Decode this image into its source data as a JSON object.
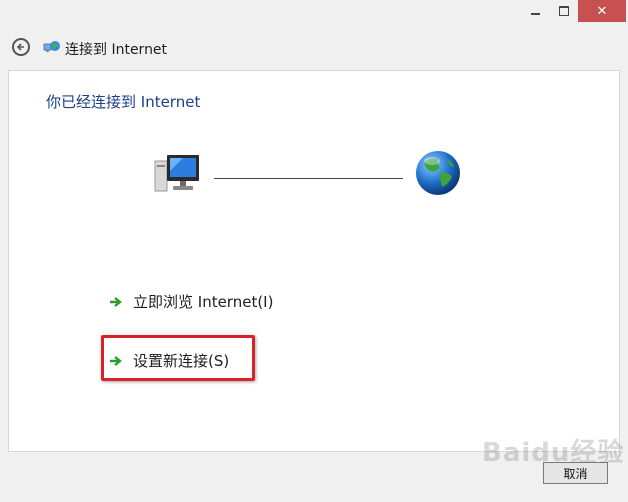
{
  "window": {
    "minimize_glyph": "—",
    "maximize_glyph": "□",
    "close_glyph": "✕"
  },
  "nav": {
    "title": "连接到 Internet",
    "back_icon": "back-arrow-icon",
    "app_icon": "network-connection-icon"
  },
  "main": {
    "heading": "你已经连接到 Internet",
    "computer_icon": "computer-icon",
    "globe_icon": "internet-globe-icon",
    "links": [
      {
        "label": "立即浏览 Internet(I)",
        "icon": "green-arrow-icon"
      },
      {
        "label": "设置新连接(S)",
        "icon": "green-arrow-icon"
      }
    ]
  },
  "footer": {
    "cancel_label": "取消",
    "watermark": "Baidu经验"
  },
  "colors": {
    "heading": "#1b3f8b",
    "highlight": "#d9222a",
    "close_button": "#c75050",
    "link_arrow": "#2d9c2d"
  }
}
